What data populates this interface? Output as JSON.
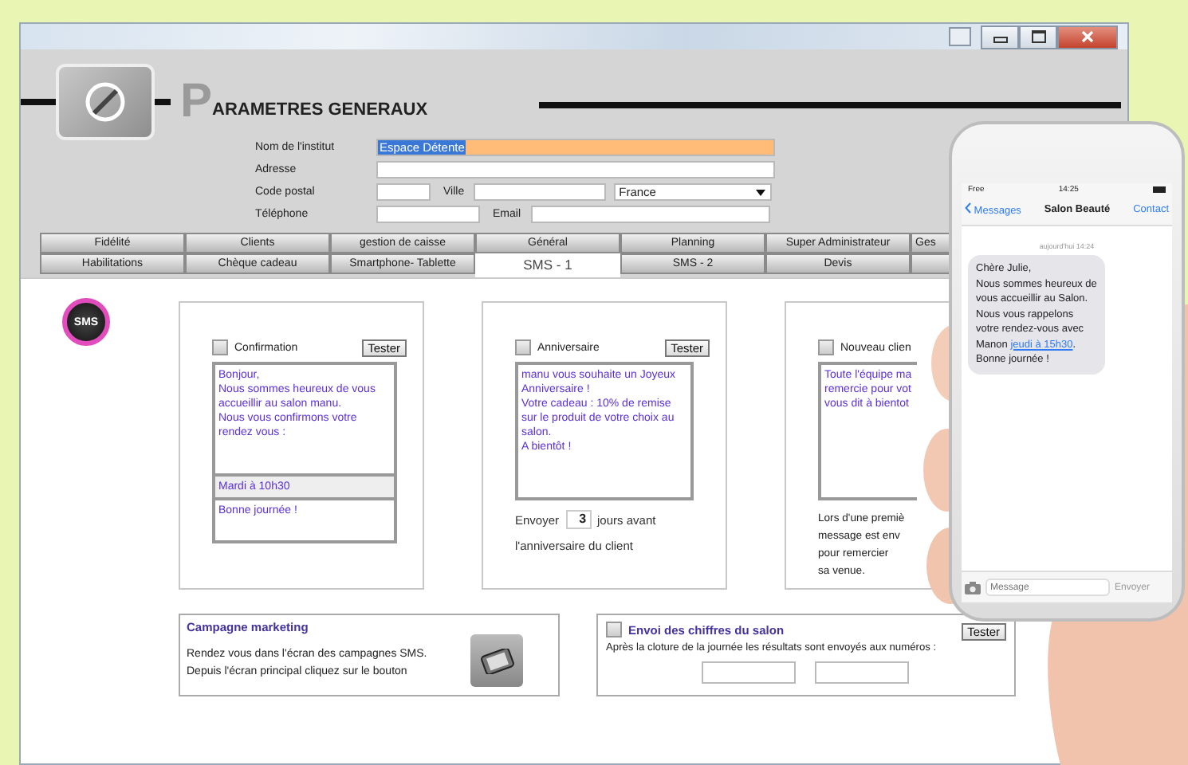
{
  "header": {
    "initial": "P",
    "title": "ARAMETRES GENERAUX"
  },
  "form": {
    "name": {
      "label": "Nom de l'institut",
      "value": "Espace Détente"
    },
    "address": {
      "label": "Adresse"
    },
    "postal": {
      "label": "Code postal",
      "city_label": "Ville",
      "country": "France"
    },
    "phone": {
      "label": "Téléphone",
      "email_label": "Email"
    }
  },
  "tabs_row_1": [
    {
      "label": "Fidélité",
      "selected": false
    },
    {
      "label": "Clients",
      "selected": false
    },
    {
      "label": "gestion de caisse",
      "selected": false
    },
    {
      "label": "Général",
      "selected": false
    },
    {
      "label": "Planning",
      "selected": false
    },
    {
      "label": "Super Administrateur",
      "selected": false
    },
    {
      "label": "Ges",
      "selected": false
    }
  ],
  "tabs_row_2": [
    {
      "label": "Habilitations",
      "selected": false
    },
    {
      "label": "Chèque cadeau",
      "selected": false
    },
    {
      "label": "Smartphone- Tablette",
      "selected": false
    },
    {
      "label": "SMS - 1",
      "selected": true
    },
    {
      "label": "SMS - 2",
      "selected": false
    },
    {
      "label": "Devis",
      "selected": false
    }
  ],
  "sms_badge": "SMS",
  "confirmation": {
    "label": "Confirmation",
    "checked": false,
    "button": "Tester",
    "message": "Bonjour,\nNous sommes heureux de vous accueillir au salon manu.\nNous vous confirmons votre rendez vous :",
    "appointment": "Mardi à 10h30",
    "closing": "Bonne journée !"
  },
  "anniversaire": {
    "label": "Anniversaire",
    "checked": false,
    "button": "Tester",
    "message": "manu vous souhaite un Joyeux Anniversaire !\nVotre cadeau : 10% de remise sur le produit de votre choix au salon.\nA bientôt !",
    "send_label": "Envoyer",
    "days": "3",
    "days_label": "jours avant",
    "after_label": "l'anniversaire du client"
  },
  "nouveau_client": {
    "label": "Nouveau clien",
    "checked": false,
    "message_lines": [
      "Toute l'équipe ma",
      "remercie pour vot",
      "vous dit à bientot"
    ],
    "description_lines": [
      "Lors d'une premiè",
      "message est env",
      "pour remercier",
      "sa venue."
    ]
  },
  "campagne": {
    "title": "Campagne marketing",
    "lines": [
      "Rendez vous dans l'écran des campagnes SMS.",
      "Depuis l'écran principal cliquez sur le bouton"
    ]
  },
  "envoi": {
    "title": "Envoi des chiffres du salon",
    "checked": false,
    "button": "Tester",
    "text": "Après la cloture de la journée les résultats sont envoyés aux numéros :"
  },
  "phone": {
    "carrier": "Free",
    "time": "14:25",
    "back": "Messages",
    "contact_name": "Salon Beauté",
    "action": "Contact",
    "timestamp": "aujourd'hui 14:24",
    "message_before": "Chère Julie,\nNous sommes heureux de vous accueillir au Salon. Nous vous rappelons votre rendez-vous avec Manon ",
    "message_link": "jeudi à 15h30",
    "message_after": ". Bonne journée !",
    "placeholder": "Message",
    "send": "Envoyer"
  }
}
